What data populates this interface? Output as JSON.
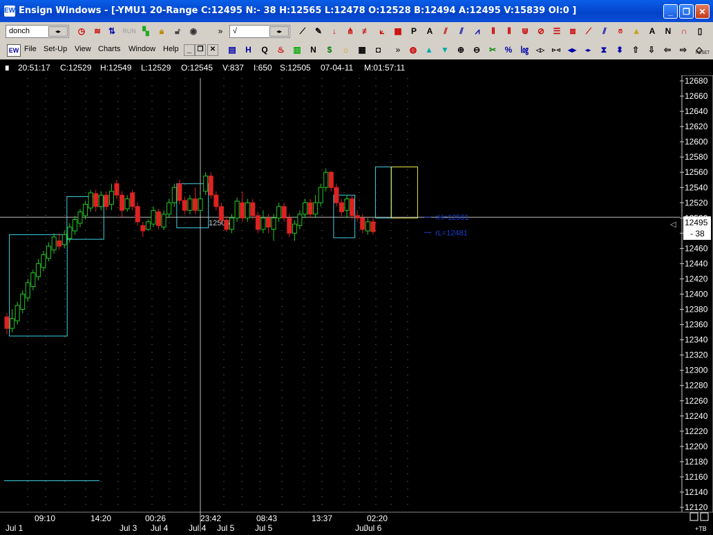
{
  "window": {
    "app_icon": "EW",
    "title": "Ensign Windows - [-YMU1 20-Range C:12495 N:- 38 H:12565 L:12478 O:12528 B:12494 A:12495 V:15839 OI:0 ]",
    "controls": {
      "minimize": "_",
      "restore": "❐",
      "close": "✕"
    }
  },
  "toolbar1": {
    "study_combo": "donch",
    "scale_combo": "√",
    "run_label": "RUN",
    "chevron": "»",
    "icons": [
      "stopwatch-icon",
      "waves-icon",
      "bar-arrows-icon",
      "run-icon",
      "color-blocks-icon",
      "lock-icon",
      "lock-icon-2",
      "globe-icon",
      "line-draw-icon",
      "pencil-icon",
      "down-arrow-icon",
      "fan-icon",
      "fib-icon",
      "gann-icon",
      "grid-icon",
      "P",
      "A",
      "channel-icon",
      "parallel-icon",
      "zigzag-icon",
      "fib-bars-icon",
      "cycle-icon",
      "cycle-icon-2",
      "ellipse-icon",
      "fib-lines-icon",
      "levels-icon",
      "pen-icon",
      "slash-icon",
      "alarm-icon",
      "triangle-icon",
      "A",
      "N",
      "magnet-icon",
      "scroll-icon"
    ]
  },
  "toolbar2": {
    "menu": [
      "File",
      "Set-Up",
      "View",
      "Charts",
      "Window",
      "Help"
    ],
    "mdi_controls": [
      "_",
      "❐",
      "✕"
    ],
    "chevron": "»",
    "reset_label": "RESET",
    "icons": [
      "chart-icon",
      "H",
      "Q",
      "fire-icon",
      "bars-icon",
      "N",
      "dollar-icon",
      "sun-icon",
      "table-icon",
      "camera-icon",
      "ring-icon",
      "up-triangle-icon",
      "down-triangle-icon",
      "zoom-in-icon",
      "zoom-out-icon",
      "tools-icon",
      "percent-icon",
      "log-icon",
      "flip-icon",
      "mirror-icon",
      "left-right-icon",
      "compress-icon",
      "hourglass-icon",
      "up-down-icon",
      "arrow-up-icon",
      "arrow-down-icon",
      "arrow-left-icon",
      "arrow-right-icon",
      "reset-icon"
    ]
  },
  "status": {
    "time": "20:51:17",
    "close": "C:12529",
    "high": "H:12549",
    "low": "L:12529",
    "open": "O:12545",
    "volume": "V:837",
    "interest": "I:650",
    "settle": "S:12505",
    "date": "07-04-11",
    "bar_time": "M:01:57:11"
  },
  "chart_data": {
    "type": "candlestick",
    "ylim": [
      12120,
      12680
    ],
    "yticks": [
      12680,
      12660,
      12640,
      12620,
      12600,
      12580,
      12560,
      12540,
      12520,
      12500,
      12480,
      12460,
      12440,
      12420,
      12400,
      12380,
      12360,
      12340,
      12320,
      12300,
      12280,
      12260,
      12240,
      12220,
      12200,
      12180,
      12160,
      12140,
      12120
    ],
    "last_price": "12495",
    "net_change": "- 38",
    "crosshair_price": "12505",
    "annotations": [
      {
        "text": "rH=12501",
        "y": 12501
      },
      {
        "text": "rL=12481",
        "y": 12481
      }
    ],
    "time_labels": [
      "09:10",
      "14:20",
      "00:26",
      "23:42",
      "08:43",
      "13:37",
      "02:20"
    ],
    "date_labels": [
      "Jul 1",
      "Jul 3",
      "Jul 4",
      "Jul 4",
      "Jul 5",
      "Jul 5",
      "Jul",
      "Jul 6"
    ],
    "corner_label": "+TB",
    "candles": [
      {
        "o": 12370,
        "c": 12355,
        "h": 12375,
        "l": 12347
      },
      {
        "o": 12355,
        "c": 12368,
        "h": 12380,
        "l": 12350
      },
      {
        "o": 12365,
        "c": 12385,
        "h": 12390,
        "l": 12360
      },
      {
        "o": 12380,
        "c": 12400,
        "h": 12405,
        "l": 12375
      },
      {
        "o": 12395,
        "c": 12415,
        "h": 12420,
        "l": 12390
      },
      {
        "o": 12410,
        "c": 12428,
        "h": 12432,
        "l": 12405
      },
      {
        "o": 12423,
        "c": 12440,
        "h": 12446,
        "l": 12418
      },
      {
        "o": 12435,
        "c": 12452,
        "h": 12457,
        "l": 12430
      },
      {
        "o": 12447,
        "c": 12463,
        "h": 12468,
        "l": 12443
      },
      {
        "o": 12458,
        "c": 12475,
        "h": 12480,
        "l": 12453
      },
      {
        "o": 12470,
        "c": 12463,
        "h": 12480,
        "l": 12458
      },
      {
        "o": 12465,
        "c": 12478,
        "h": 12483,
        "l": 12460
      },
      {
        "o": 12473,
        "c": 12488,
        "h": 12493,
        "l": 12468
      },
      {
        "o": 12483,
        "c": 12498,
        "h": 12503,
        "l": 12478
      },
      {
        "o": 12493,
        "c": 12508,
        "h": 12512,
        "l": 12488
      },
      {
        "o": 12503,
        "c": 12518,
        "h": 12522,
        "l": 12498
      },
      {
        "o": 12513,
        "c": 12533,
        "h": 12537,
        "l": 12508
      },
      {
        "o": 12532,
        "c": 12515,
        "h": 12537,
        "l": 12508
      },
      {
        "o": 12515,
        "c": 12530,
        "h": 12535,
        "l": 12510
      },
      {
        "o": 12530,
        "c": 12515,
        "h": 12535,
        "l": 12510
      },
      {
        "o": 12518,
        "c": 12535,
        "h": 12545,
        "l": 12510
      },
      {
        "o": 12545,
        "c": 12530,
        "h": 12550,
        "l": 12525
      },
      {
        "o": 12530,
        "c": 12510,
        "h": 12535,
        "l": 12500
      },
      {
        "o": 12512,
        "c": 12525,
        "h": 12530,
        "l": 12508
      },
      {
        "o": 12533,
        "c": 12515,
        "h": 12537,
        "l": 12510
      },
      {
        "o": 12515,
        "c": 12495,
        "h": 12520,
        "l": 12490
      },
      {
        "o": 12490,
        "c": 12483,
        "h": 12495,
        "l": 12475
      },
      {
        "o": 12485,
        "c": 12495,
        "h": 12498,
        "l": 12483
      },
      {
        "o": 12492,
        "c": 12510,
        "h": 12515,
        "l": 12488
      },
      {
        "o": 12508,
        "c": 12490,
        "h": 12512,
        "l": 12485
      },
      {
        "o": 12488,
        "c": 12505,
        "h": 12510,
        "l": 12484
      },
      {
        "o": 12505,
        "c": 12520,
        "h": 12525,
        "l": 12500
      },
      {
        "o": 12520,
        "c": 12540,
        "h": 12545,
        "l": 12515
      },
      {
        "o": 12545,
        "c": 12523,
        "h": 12550,
        "l": 12518
      },
      {
        "o": 12523,
        "c": 12510,
        "h": 12528,
        "l": 12505
      },
      {
        "o": 12510,
        "c": 12525,
        "h": 12530,
        "l": 12505
      },
      {
        "o": 12525,
        "c": 12510,
        "h": 12540,
        "l": 12505
      },
      {
        "o": 12510,
        "c": 12525,
        "h": 12530,
        "l": 12505
      },
      {
        "o": 12535,
        "c": 12555,
        "h": 12560,
        "l": 12530
      },
      {
        "o": 12555,
        "c": 12530,
        "h": 12560,
        "l": 12525
      },
      {
        "o": 12530,
        "c": 12515,
        "h": 12535,
        "l": 12510
      },
      {
        "o": 12515,
        "c": 12497,
        "h": 12520,
        "l": 12492
      },
      {
        "o": 12497,
        "c": 12485,
        "h": 12502,
        "l": 12482
      },
      {
        "o": 12485,
        "c": 12500,
        "h": 12505,
        "l": 12480
      },
      {
        "o": 12500,
        "c": 12522,
        "h": 12527,
        "l": 12495
      },
      {
        "o": 12520,
        "c": 12500,
        "h": 12535,
        "l": 12495
      },
      {
        "o": 12500,
        "c": 12520,
        "h": 12525,
        "l": 12495
      },
      {
        "o": 12520,
        "c": 12503,
        "h": 12525,
        "l": 12498
      },
      {
        "o": 12503,
        "c": 12485,
        "h": 12508,
        "l": 12480
      },
      {
        "o": 12485,
        "c": 12500,
        "h": 12510,
        "l": 12480
      },
      {
        "o": 12500,
        "c": 12488,
        "h": 12505,
        "l": 12480
      },
      {
        "o": 12485,
        "c": 12500,
        "h": 12505,
        "l": 12470
      },
      {
        "o": 12500,
        "c": 12515,
        "h": 12520,
        "l": 12495
      },
      {
        "o": 12515,
        "c": 12500,
        "h": 12520,
        "l": 12495
      },
      {
        "o": 12500,
        "c": 12480,
        "h": 12505,
        "l": 12475
      },
      {
        "o": 12480,
        "c": 12492,
        "h": 12497,
        "l": 12470
      },
      {
        "o": 12490,
        "c": 12505,
        "h": 12510,
        "l": 12485
      },
      {
        "o": 12505,
        "c": 12520,
        "h": 12525,
        "l": 12500
      },
      {
        "o": 12520,
        "c": 12505,
        "h": 12525,
        "l": 12500
      },
      {
        "o": 12505,
        "c": 12520,
        "h": 12530,
        "l": 12500
      },
      {
        "o": 12520,
        "c": 12540,
        "h": 12545,
        "l": 12515
      },
      {
        "o": 12540,
        "c": 12560,
        "h": 12565,
        "l": 12535
      },
      {
        "o": 12560,
        "c": 12540,
        "h": 12562,
        "l": 12535
      },
      {
        "o": 12540,
        "c": 12520,
        "h": 12545,
        "l": 12515
      },
      {
        "o": 12520,
        "c": 12508,
        "h": 12525,
        "l": 12503
      },
      {
        "o": 12510,
        "c": 12525,
        "h": 12530,
        "l": 12500
      },
      {
        "o": 12525,
        "c": 12503,
        "h": 12530,
        "l": 12498
      },
      {
        "o": 12503,
        "c": 12500,
        "h": 12510,
        "l": 12495
      },
      {
        "o": 12500,
        "c": 12485,
        "h": 12505,
        "l": 12480
      },
      {
        "o": 12483,
        "c": 12495,
        "h": 12500,
        "l": 12478
      },
      {
        "o": 12495,
        "c": 12482,
        "h": 12500,
        "l": 12478
      }
    ],
    "boxes": [
      {
        "i0": 1,
        "i1": 11,
        "top": 12478,
        "bottom": 12345,
        "color": "#3fd0e0"
      },
      {
        "i0": 12,
        "i1": 18,
        "top": 12528,
        "bottom": 12472,
        "color": "#3fd0e0"
      },
      {
        "i0": 33,
        "i1": 38,
        "top": 12545,
        "bottom": 12487,
        "color": "#3fd0e0"
      },
      {
        "i0": 63,
        "i1": 66,
        "top": 12530,
        "bottom": 12474,
        "color": "#3fd0e0"
      },
      {
        "i0": 71,
        "i1": 73,
        "top": 12567,
        "bottom": 12500,
        "color": "#3fd0e0"
      },
      {
        "i0": 74,
        "i1": 78,
        "top": 12567,
        "bottom": 12500,
        "color": "#e8e84a"
      }
    ],
    "bottom_line": {
      "y": 12155,
      "color": "#3fd0e0"
    }
  }
}
